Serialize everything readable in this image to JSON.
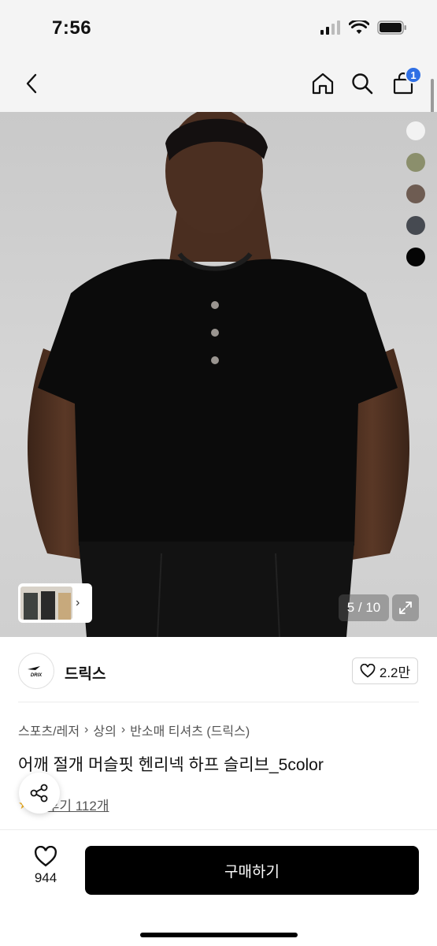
{
  "status_bar": {
    "time": "7:56"
  },
  "nav": {
    "cart_count": "1"
  },
  "gallery": {
    "counter": "5 / 10",
    "swatches": [
      {
        "name": "white",
        "color": "#f2f2f2"
      },
      {
        "name": "olive",
        "color": "#8b8f6c"
      },
      {
        "name": "brown",
        "color": "#6e5c52"
      },
      {
        "name": "charcoal",
        "color": "#464a51"
      },
      {
        "name": "black",
        "color": "#050505"
      }
    ]
  },
  "brand": {
    "name": "드릭스",
    "logo_text": "DRIX",
    "likes": "2.2만"
  },
  "breadcrumb": [
    "스포츠/레저",
    "상의",
    "반소매 티셔츠 (드릭스)"
  ],
  "product": {
    "title": "어깨 절개 머슬핏 헨리넥 하프 슬리브_5color",
    "rating": "5",
    "reviews": "후기 112개"
  },
  "bottom": {
    "wish_count": "944",
    "buy_label": "구매하기"
  },
  "colors": {
    "accent": "#2f6fe4",
    "buy_button": "#000000"
  }
}
